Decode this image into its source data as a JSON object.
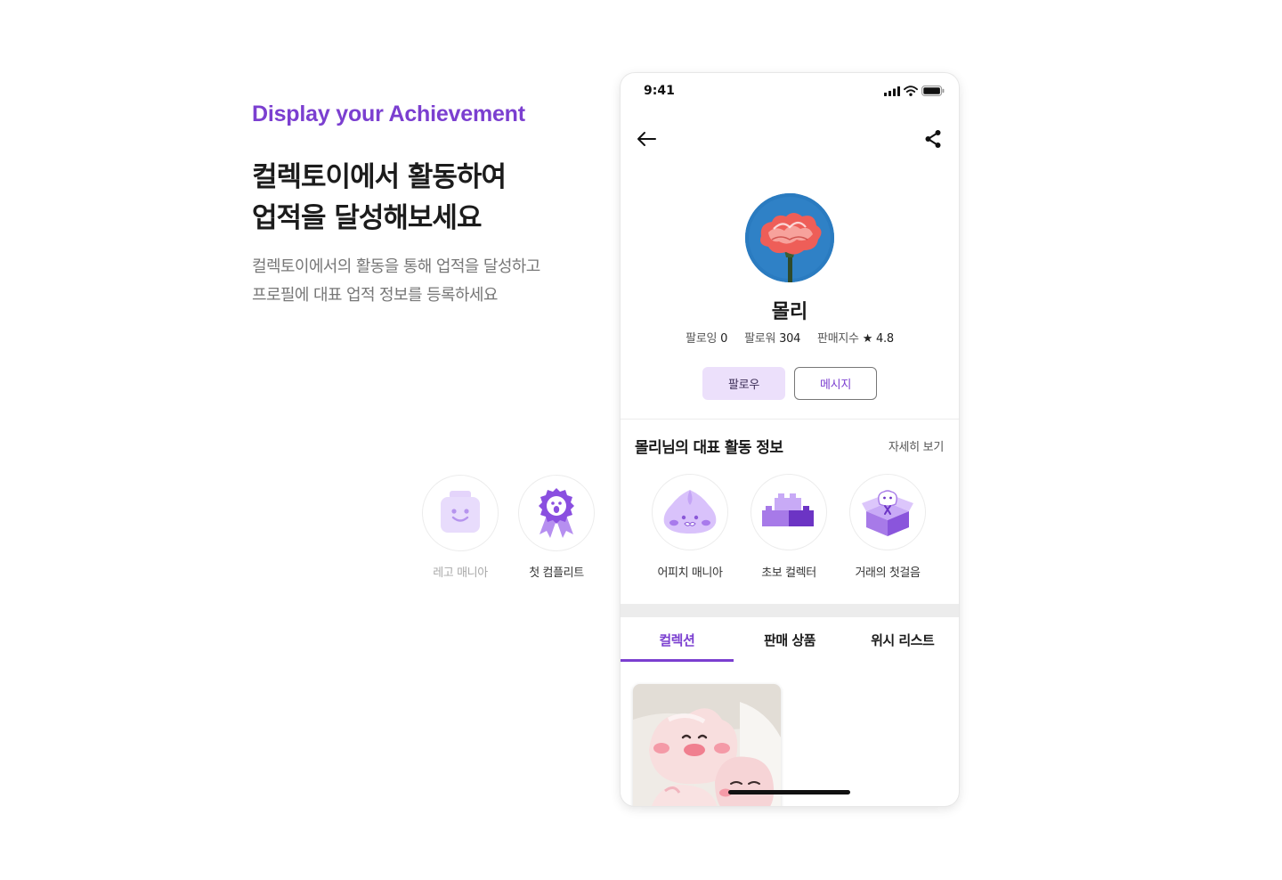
{
  "intro": {
    "eyebrow": "Display your Achievement",
    "headline_line1": "컬렉토이에서 활동하여",
    "headline_line2": "업적을 달성해보세요",
    "desc_line1": "컬렉토이에서의 활동을 통해 업적을 달성하고",
    "desc_line2": "프로필에 대표 업적 정보를 등록하세요"
  },
  "side_badges": [
    {
      "label": "레고 매니아",
      "icon": "lego-face-icon",
      "state": "inactive"
    },
    {
      "label": "첫 컴플리트",
      "icon": "ribbon-medal-icon",
      "state": "active"
    }
  ],
  "phone": {
    "status": {
      "time": "9:41",
      "icons": [
        "signal-icon",
        "wifi-icon",
        "battery-icon"
      ]
    },
    "nav": {
      "back_icon": "arrow-left-icon",
      "share_icon": "share-icon"
    },
    "profile": {
      "name": "몰리",
      "following_label": "팔로잉",
      "following_count": "0",
      "followers_label": "팔로워",
      "followers_count": "304",
      "rating_label": "판매지수",
      "rating_star": "★",
      "rating_value": "4.8"
    },
    "buttons": {
      "follow": "팔로우",
      "message": "메시지"
    },
    "achievements": {
      "title": "몰리님의 대표 활동 정보",
      "more": "자세히 보기",
      "items": [
        {
          "label": "어피치 매니아",
          "icon": "apeach-icon"
        },
        {
          "label": "초보 컬렉터",
          "icon": "blocks-icon"
        },
        {
          "label": "거래의 첫걸음",
          "icon": "gift-box-icon"
        }
      ]
    },
    "tabs": [
      {
        "label": "컬렉션",
        "active": true
      },
      {
        "label": "판매 상품",
        "active": false
      },
      {
        "label": "위시 리스트",
        "active": false
      }
    ],
    "colors": {
      "accent": "#7b3fd0",
      "follow_bg": "#ece0fb",
      "band": "#ececec"
    }
  }
}
